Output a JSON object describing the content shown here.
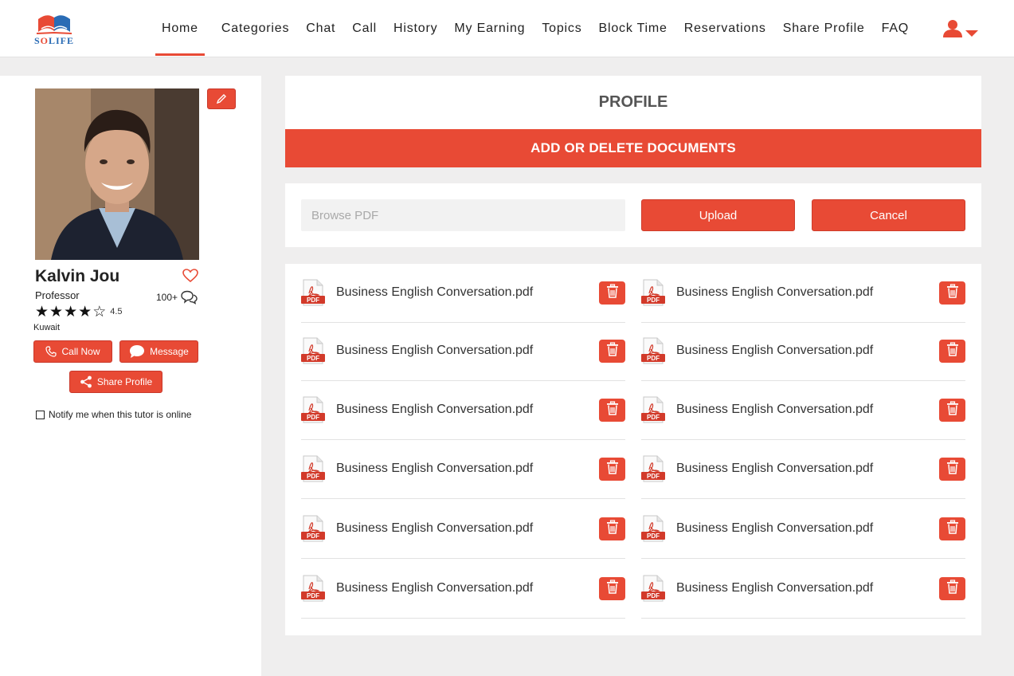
{
  "brand": {
    "logo_text": "SOLIFE",
    "accent": "#e84a35",
    "logo_blue": "#2a6cb5"
  },
  "nav": {
    "items": [
      {
        "label": "Home",
        "name": "nav-home",
        "active": true
      },
      {
        "label": "Categories",
        "name": "nav-categories"
      },
      {
        "label": "Chat",
        "name": "nav-chat"
      },
      {
        "label": "Call",
        "name": "nav-call"
      },
      {
        "label": "History",
        "name": "nav-history"
      },
      {
        "label": "My Earning",
        "name": "nav-my-earning"
      },
      {
        "label": "Topics",
        "name": "nav-topics"
      },
      {
        "label": "Block Time",
        "name": "nav-block-time"
      },
      {
        "label": "Reservations",
        "name": "nav-reservations"
      },
      {
        "label": "Share Profile",
        "name": "nav-share-profile"
      },
      {
        "label": "FAQ",
        "name": "nav-faq"
      }
    ],
    "user_icon": "user-icon",
    "dropdown_icon": "caret-down-icon"
  },
  "tutor": {
    "name": "Kalvin Jou",
    "title": "Professor",
    "reviews": "100+",
    "rating": "4.5",
    "stars_filled": 4,
    "stars_total": 5,
    "location": "Kuwait",
    "call_label": "Call Now",
    "message_label": "Message",
    "share_label": "Share Profile",
    "notify_label": "Notify me when this tutor is online"
  },
  "main": {
    "title": "PROFILE",
    "banner": "ADD OR DELETE DOCUMENTS",
    "browse_placeholder": "Browse PDF",
    "upload_label": "Upload",
    "cancel_label": "Cancel",
    "pdf_badge": "PDF",
    "documents": [
      "Business English Conversation.pdf",
      "Business English Conversation.pdf",
      "Business English Conversation.pdf",
      "Business English Conversation.pdf",
      "Business English Conversation.pdf",
      "Business English Conversation.pdf",
      "Business English Conversation.pdf",
      "Business English Conversation.pdf",
      "Business English Conversation.pdf",
      "Business English Conversation.pdf",
      "Business English Conversation.pdf",
      "Business English Conversation.pdf"
    ]
  }
}
